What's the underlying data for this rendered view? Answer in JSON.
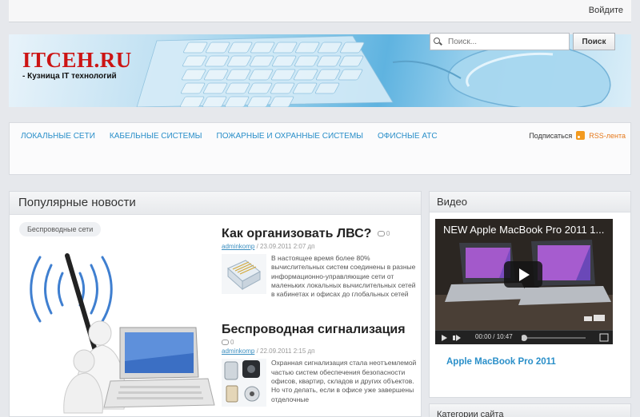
{
  "header": {
    "login_label": "Войдите"
  },
  "logo": {
    "name": "ITCEH.RU",
    "tagline": "- Кузница IT технологий"
  },
  "nav": {
    "items": [
      {
        "label": "Локальные сети"
      },
      {
        "label": "Кабельные системы"
      },
      {
        "label": "Пожарные и охранные системы"
      },
      {
        "label": "Офисные АТС"
      }
    ],
    "subscribe_label": "Подписаться",
    "rss_label": "RSS-лента",
    "search": {
      "placeholder": "Поиск...",
      "button_label": "Поиск"
    }
  },
  "popular": {
    "heading": "Популярные новости",
    "tag": "Беспроводные сети",
    "articles": [
      {
        "title": "Как организовать ЛВС?",
        "comments": "0",
        "author": "adminkomp",
        "date": " / 23.09.2011 2:07 дп",
        "excerpt": "В настоящее время более 80% вычислительных систем соединены в разные информационно-управляющие сети от маленьких локальных вычислительных сетей в кабинетах и офисах до глобальных сетей"
      },
      {
        "title": "Беспроводная сигнализация",
        "comments": "0",
        "author": "adminkomp",
        "date": " / 22.09.2011 2:15 дп",
        "excerpt": "Охранная сигнализация стала неотъемлемой частью систем обеспечения безопасности офисов, квартир, складов и других объектов. Но что делать, если в офисе уже завершены отделочные"
      }
    ]
  },
  "video": {
    "heading": "Видео",
    "player_title": "NEW Apple MacBook Pro 2011 1...",
    "time": "00:00 / 10:47",
    "caption": "Apple MacBook Pro 2011"
  },
  "categories": {
    "heading": "Категории сайта"
  }
}
